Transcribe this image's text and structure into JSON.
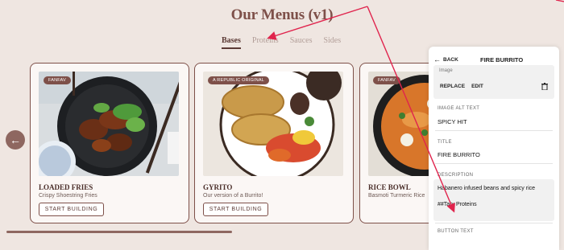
{
  "page": {
    "title": "Our Menus (v1)"
  },
  "tabs": [
    {
      "label": "Bases",
      "active": true
    },
    {
      "label": "Proteins",
      "active": false
    },
    {
      "label": "Sauces",
      "active": false
    },
    {
      "label": "Sides",
      "active": false
    }
  ],
  "carousel": {
    "prev_icon": "arrow-left-icon",
    "cards": [
      {
        "badge": "FANFAV",
        "name": "LOADED FRIES",
        "desc": "Crispy Shoestring Fries",
        "cta": "START BUILDING"
      },
      {
        "badge": "A REPUBLIC ORIGINAL",
        "name": "GYRITO",
        "desc": "Our version of a Burrito!",
        "cta": "START BUILDING"
      },
      {
        "badge": "FANFAV",
        "name": "RICE BOWL",
        "desc": "Basmoti Turmeric Rice"
      }
    ]
  },
  "panel": {
    "back_label": "BACK",
    "title": "FIRE BURRITO",
    "image_label": "Image",
    "replace_label": "REPLACE",
    "edit_label": "EDIT",
    "alt_label": "IMAGE ALT TEXT",
    "alt_value": "SPICY HIT",
    "title_label": "TITLE",
    "title_value": "FIRE BURRITO",
    "desc_label": "DESCRIPTION",
    "desc_line1": "Habanero infused beans and spicy rice",
    "desc_line2": "##Tab: Proteins",
    "button_label": "BUTTON TEXT"
  },
  "colors": {
    "accent": "#7e5049",
    "arrow": "#e0244d",
    "background": "#efe6e1"
  }
}
